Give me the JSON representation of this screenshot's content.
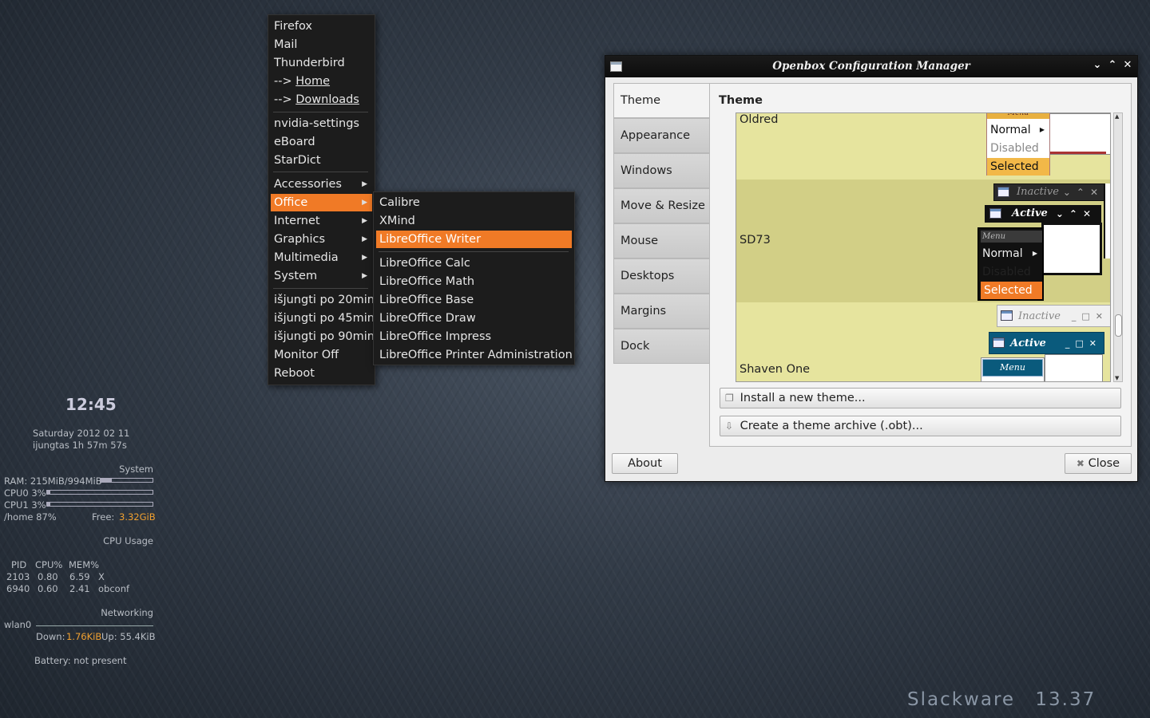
{
  "desktop": {
    "brand": "Slackware 13.37"
  },
  "conky": {
    "time": "12:45",
    "date": "Saturday 2012 02 11",
    "uptime": "ijungtas 1h 57m 57s",
    "system_header": "System",
    "ram_label": "RAM: 215MiB/994MiB",
    "ram_fraction": 0.22,
    "cpu0_label": "CPU0 3%",
    "cpu0_fraction": 0.03,
    "cpu1_label": "CPU1 3%",
    "cpu1_fraction": 0.03,
    "home_label": "/home 87%",
    "free_label": "Free:",
    "free_value": "3.32GiB",
    "cpu_usage_header": "CPU Usage",
    "proc_header": [
      "PID",
      "CPU%",
      "MEM%"
    ],
    "procs": [
      [
        "2103",
        "0.80",
        "6.59",
        "X"
      ],
      [
        "6940",
        "0.60",
        "2.41",
        "obconf"
      ]
    ],
    "net_header": "Networking",
    "iface": "wlan0",
    "down_label": "Down:",
    "down_value": "1.76KiB",
    "up_label": "Up: 55.4KiB",
    "battery": "Battery: not present"
  },
  "root_menu": {
    "group1": [
      "Firefox",
      "Mail",
      "Thunderbird"
    ],
    "home_prefix": "--> ",
    "home_label": "Home",
    "downloads_prefix": "--> ",
    "downloads_label": "Downloads",
    "group2": [
      "nvidia-settings",
      "eBoard",
      "StarDict"
    ],
    "submenus": [
      "Accessories",
      "Office",
      "Internet",
      "Graphics",
      "Multimedia",
      "System"
    ],
    "group4": [
      "išjungti po 20min",
      "išjungti po 45min",
      "išjungti po 90min",
      "Monitor Off",
      "Reboot"
    ]
  },
  "office_menu": {
    "top": [
      "Calibre",
      "XMind",
      "LibreOffice Writer"
    ],
    "bottom": [
      "LibreOffice Calc",
      "LibreOffice Math",
      "LibreOffice Base",
      "LibreOffice Draw",
      "LibreOffice Impress",
      "LibreOffice Printer Administration"
    ]
  },
  "obconf": {
    "title": "Openbox Configuration Manager",
    "tabs": [
      "Theme",
      "Appearance",
      "Windows",
      "Move & Resize",
      "Mouse",
      "Desktops",
      "Margins",
      "Dock"
    ],
    "panel_title": "Theme",
    "themes": [
      "Oldred",
      "SD73",
      "Shaven One"
    ],
    "preview": {
      "menu": "Menu",
      "normal": "Normal",
      "disabled": "Disabled",
      "selected": "Selected",
      "inactive": "Inactive",
      "active": "Active"
    },
    "install_button": "Install a new theme...",
    "archive_button": "Create a theme archive (.obt)...",
    "about_button": "About",
    "close_button": "Close"
  },
  "colors": {
    "menu_highlight": "#f07a26",
    "conky_highlight": "#f0a030",
    "theme_list_bg": "#e6e49e",
    "theme_selected_row": "#d2cf86"
  }
}
